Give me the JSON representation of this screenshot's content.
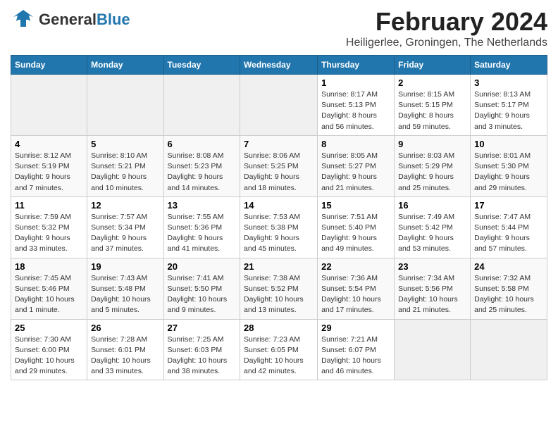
{
  "header": {
    "logo_general": "General",
    "logo_blue": "Blue",
    "title": "February 2024",
    "subtitle": "Heiligerlee, Groningen, The Netherlands"
  },
  "days_of_week": [
    "Sunday",
    "Monday",
    "Tuesday",
    "Wednesday",
    "Thursday",
    "Friday",
    "Saturday"
  ],
  "weeks": [
    [
      {
        "day": "",
        "info": ""
      },
      {
        "day": "",
        "info": ""
      },
      {
        "day": "",
        "info": ""
      },
      {
        "day": "",
        "info": ""
      },
      {
        "day": "1",
        "info": "Sunrise: 8:17 AM\nSunset: 5:13 PM\nDaylight: 8 hours and 56 minutes."
      },
      {
        "day": "2",
        "info": "Sunrise: 8:15 AM\nSunset: 5:15 PM\nDaylight: 8 hours and 59 minutes."
      },
      {
        "day": "3",
        "info": "Sunrise: 8:13 AM\nSunset: 5:17 PM\nDaylight: 9 hours and 3 minutes."
      }
    ],
    [
      {
        "day": "4",
        "info": "Sunrise: 8:12 AM\nSunset: 5:19 PM\nDaylight: 9 hours and 7 minutes."
      },
      {
        "day": "5",
        "info": "Sunrise: 8:10 AM\nSunset: 5:21 PM\nDaylight: 9 hours and 10 minutes."
      },
      {
        "day": "6",
        "info": "Sunrise: 8:08 AM\nSunset: 5:23 PM\nDaylight: 9 hours and 14 minutes."
      },
      {
        "day": "7",
        "info": "Sunrise: 8:06 AM\nSunset: 5:25 PM\nDaylight: 9 hours and 18 minutes."
      },
      {
        "day": "8",
        "info": "Sunrise: 8:05 AM\nSunset: 5:27 PM\nDaylight: 9 hours and 21 minutes."
      },
      {
        "day": "9",
        "info": "Sunrise: 8:03 AM\nSunset: 5:29 PM\nDaylight: 9 hours and 25 minutes."
      },
      {
        "day": "10",
        "info": "Sunrise: 8:01 AM\nSunset: 5:30 PM\nDaylight: 9 hours and 29 minutes."
      }
    ],
    [
      {
        "day": "11",
        "info": "Sunrise: 7:59 AM\nSunset: 5:32 PM\nDaylight: 9 hours and 33 minutes."
      },
      {
        "day": "12",
        "info": "Sunrise: 7:57 AM\nSunset: 5:34 PM\nDaylight: 9 hours and 37 minutes."
      },
      {
        "day": "13",
        "info": "Sunrise: 7:55 AM\nSunset: 5:36 PM\nDaylight: 9 hours and 41 minutes."
      },
      {
        "day": "14",
        "info": "Sunrise: 7:53 AM\nSunset: 5:38 PM\nDaylight: 9 hours and 45 minutes."
      },
      {
        "day": "15",
        "info": "Sunrise: 7:51 AM\nSunset: 5:40 PM\nDaylight: 9 hours and 49 minutes."
      },
      {
        "day": "16",
        "info": "Sunrise: 7:49 AM\nSunset: 5:42 PM\nDaylight: 9 hours and 53 minutes."
      },
      {
        "day": "17",
        "info": "Sunrise: 7:47 AM\nSunset: 5:44 PM\nDaylight: 9 hours and 57 minutes."
      }
    ],
    [
      {
        "day": "18",
        "info": "Sunrise: 7:45 AM\nSunset: 5:46 PM\nDaylight: 10 hours and 1 minute."
      },
      {
        "day": "19",
        "info": "Sunrise: 7:43 AM\nSunset: 5:48 PM\nDaylight: 10 hours and 5 minutes."
      },
      {
        "day": "20",
        "info": "Sunrise: 7:41 AM\nSunset: 5:50 PM\nDaylight: 10 hours and 9 minutes."
      },
      {
        "day": "21",
        "info": "Sunrise: 7:38 AM\nSunset: 5:52 PM\nDaylight: 10 hours and 13 minutes."
      },
      {
        "day": "22",
        "info": "Sunrise: 7:36 AM\nSunset: 5:54 PM\nDaylight: 10 hours and 17 minutes."
      },
      {
        "day": "23",
        "info": "Sunrise: 7:34 AM\nSunset: 5:56 PM\nDaylight: 10 hours and 21 minutes."
      },
      {
        "day": "24",
        "info": "Sunrise: 7:32 AM\nSunset: 5:58 PM\nDaylight: 10 hours and 25 minutes."
      }
    ],
    [
      {
        "day": "25",
        "info": "Sunrise: 7:30 AM\nSunset: 6:00 PM\nDaylight: 10 hours and 29 minutes."
      },
      {
        "day": "26",
        "info": "Sunrise: 7:28 AM\nSunset: 6:01 PM\nDaylight: 10 hours and 33 minutes."
      },
      {
        "day": "27",
        "info": "Sunrise: 7:25 AM\nSunset: 6:03 PM\nDaylight: 10 hours and 38 minutes."
      },
      {
        "day": "28",
        "info": "Sunrise: 7:23 AM\nSunset: 6:05 PM\nDaylight: 10 hours and 42 minutes."
      },
      {
        "day": "29",
        "info": "Sunrise: 7:21 AM\nSunset: 6:07 PM\nDaylight: 10 hours and 46 minutes."
      },
      {
        "day": "",
        "info": ""
      },
      {
        "day": "",
        "info": ""
      }
    ]
  ]
}
